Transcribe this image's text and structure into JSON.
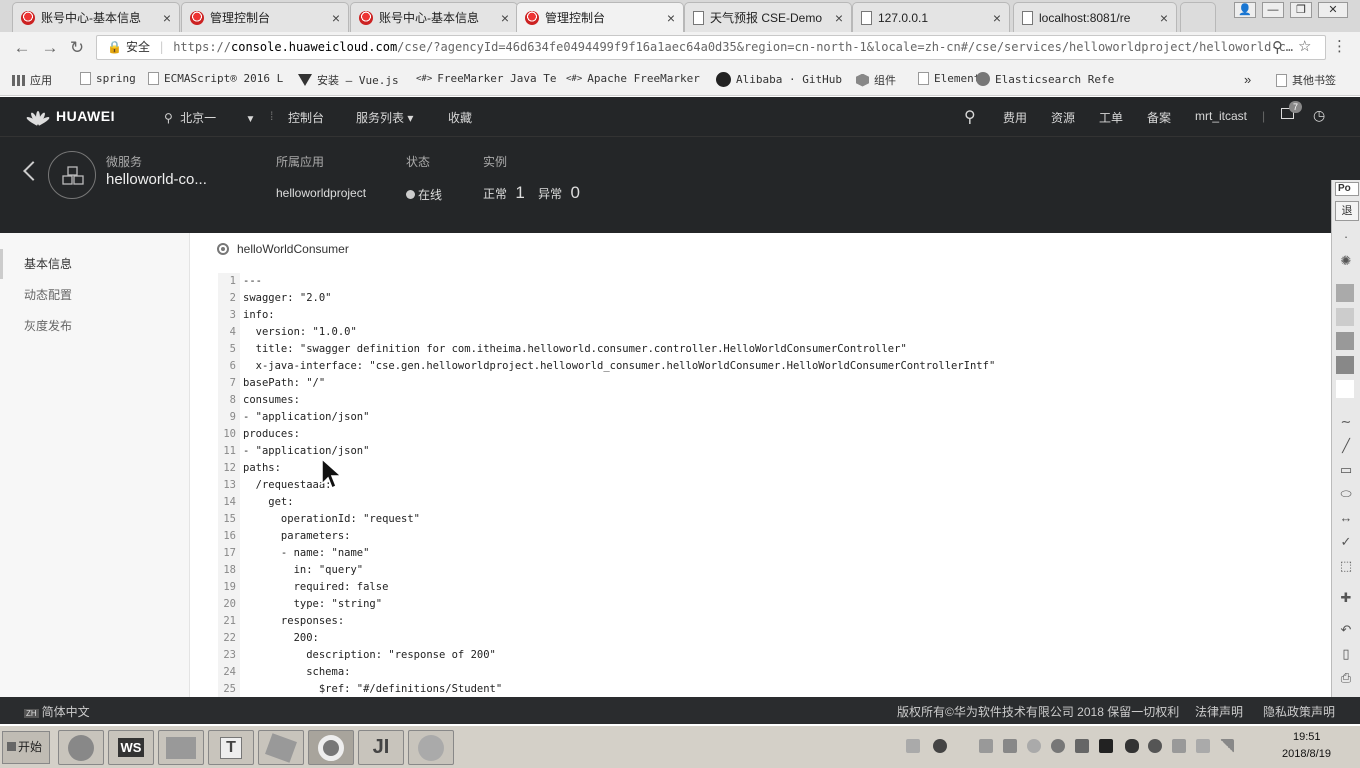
{
  "browser": {
    "tabs": [
      {
        "title": "账号中心-基本信息",
        "active": false,
        "icon": "huawei-favicon"
      },
      {
        "title": "管理控制台",
        "active": false,
        "icon": "huawei-favicon"
      },
      {
        "title": "账号中心-基本信息",
        "active": false,
        "icon": "huawei-favicon"
      },
      {
        "title": "管理控制台",
        "active": true,
        "icon": "huawei-favicon"
      },
      {
        "title": "天气预报 CSE-Demo",
        "active": false,
        "icon": "page-icon"
      },
      {
        "title": "127.0.0.1",
        "active": false,
        "icon": "page-icon"
      },
      {
        "title": "localhost:8081/re",
        "active": false,
        "icon": "page-icon"
      }
    ],
    "close_glyph": "×",
    "window_controls": [
      "👤",
      "—",
      "❐",
      "✕"
    ],
    "address": {
      "secure_label": "安全",
      "scheme": "https://",
      "host": "console.huaweicloud.com",
      "path": "/cse/?agencyId=46d634fe0494499f9f16a1aec64a0d35&region=cn-north-1&locale=zh-cn#/cse/services/helloworldproject/helloworld-c…"
    },
    "bookmarks": [
      {
        "label": "应用",
        "icon": "apps-icon"
      },
      {
        "label": "spring",
        "icon": "page-icon"
      },
      {
        "label": "ECMAScript® 2016 L",
        "icon": "page-icon"
      },
      {
        "label": "安装 — Vue.js",
        "icon": "vue-icon"
      },
      {
        "label": "FreeMarker Java Te",
        "icon": "code-icon"
      },
      {
        "label": "Apache FreeMarker",
        "icon": "code-icon"
      },
      {
        "label": "Alibaba · GitHub",
        "icon": "github-icon"
      },
      {
        "label": "组件",
        "icon": "element-icon"
      },
      {
        "label": "Element",
        "icon": "page-icon"
      },
      {
        "label": "Elasticsearch Refe",
        "icon": "elastic-icon"
      }
    ],
    "bookmarks_more": "»",
    "other_bookmarks": "其他书签"
  },
  "console": {
    "brand": "HUAWEI",
    "region": "北京一",
    "nav": [
      "控制台",
      "服务列表 ▾",
      "收藏"
    ],
    "right_nav": [
      "费用",
      "资源",
      "工单",
      "备案",
      "mrt_itcast"
    ],
    "notification_count": "7"
  },
  "service": {
    "type_label": "微服务",
    "name": "helloworld-co...",
    "app_label": "所属应用",
    "app_value": "helloworldproject",
    "status_label": "状态",
    "status_value": "在线",
    "instance_label": "实例",
    "normal_label": "正常",
    "normal_count": "1",
    "abnormal_label": "异常",
    "abnormal_count": "0"
  },
  "sidebar": {
    "items": [
      "基本信息",
      "动态配置",
      "灰度发布"
    ]
  },
  "main": {
    "schema_name": "helloWorldConsumer",
    "code_lines": [
      "---",
      "swagger: \"2.0\"",
      "info:",
      "  version: \"1.0.0\"",
      "  title: \"swagger definition for com.itheima.helloworld.consumer.controller.HelloWorldConsumerController\"",
      "  x-java-interface: \"cse.gen.helloworldproject.helloworld_consumer.helloWorldConsumer.HelloWorldConsumerControllerIntf\"",
      "basePath: \"/\"",
      "consumes:",
      "- \"application/json\"",
      "produces:",
      "- \"application/json\"",
      "paths:",
      "  /requestaaa:",
      "    get:",
      "      operationId: \"request\"",
      "      parameters:",
      "      - name: \"name\"",
      "        in: \"query\"",
      "        required: false",
      "        type: \"string\"",
      "      responses:",
      "        200:",
      "          description: \"response of 200\"",
      "          schema:",
      "            $ref: \"#/definitions/Student\""
    ]
  },
  "footer": {
    "language": "简体中文",
    "copyright": "版权所有©华为软件技术有限公司 2018 保留一切权利",
    "legal": "法律声明",
    "privacy": "隐私政策声明"
  },
  "side_tool": {
    "title": "Po",
    "exit": "退"
  },
  "taskbar": {
    "start": "开始",
    "time": "19:51",
    "date": "2018/8/19"
  },
  "colors": {
    "header_bg": "#242628",
    "footer_bg": "#2a2c2e",
    "sidebar_bg": "#f7f7f7",
    "taskbar_bg": "#d4d0c8"
  }
}
